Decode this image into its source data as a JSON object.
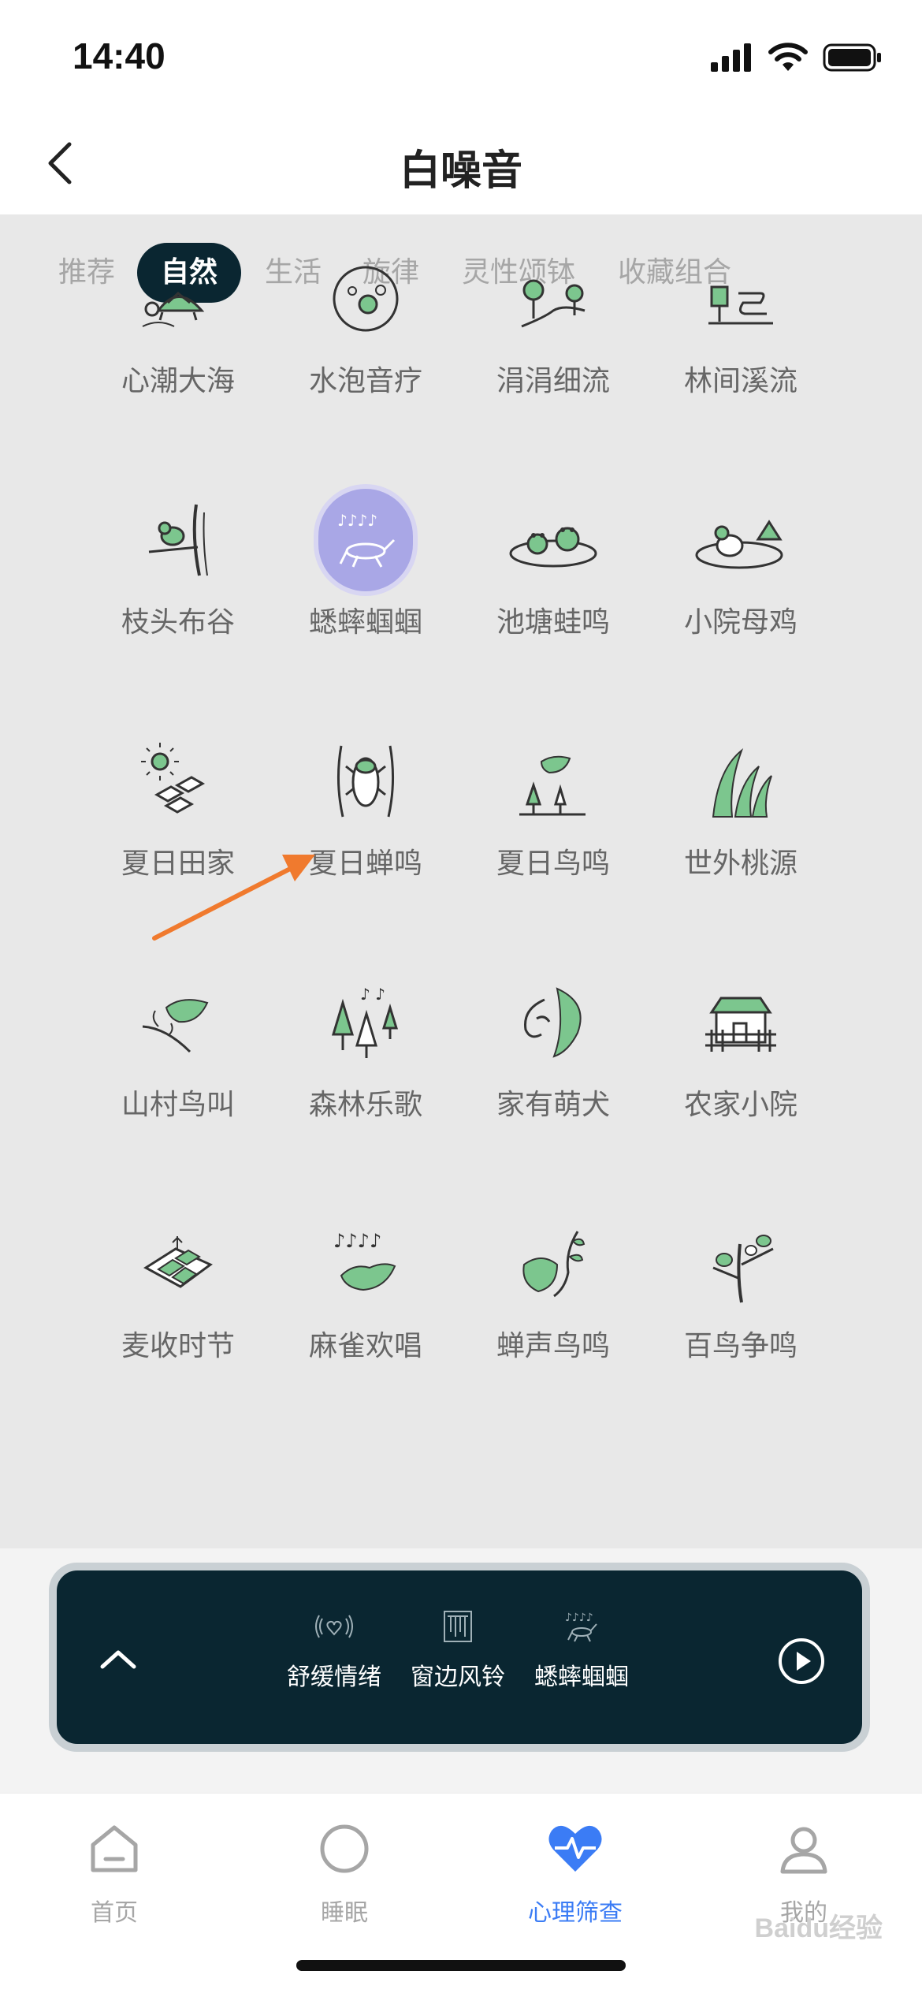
{
  "status_bar": {
    "time": "14:40"
  },
  "nav": {
    "title": "白噪音"
  },
  "tabs": [
    {
      "label": "推荐",
      "active": false
    },
    {
      "label": "自然",
      "active": true
    },
    {
      "label": "生活",
      "active": false
    },
    {
      "label": "旋律",
      "active": false
    },
    {
      "label": "灵性颂钵",
      "active": false
    },
    {
      "label": "收藏组合",
      "active": false
    }
  ],
  "sounds": [
    {
      "label": "心潮大海",
      "icon": "turtle-icon"
    },
    {
      "label": "水泡音疗",
      "icon": "bubbles-icon"
    },
    {
      "label": "涓涓细流",
      "icon": "stream-trees-icon"
    },
    {
      "label": "林间溪流",
      "icon": "forest-stream-icon"
    },
    {
      "label": "枝头布谷",
      "icon": "cuckoo-branch-icon"
    },
    {
      "label": "蟋蟀蝈蝈",
      "icon": "cricket-icon",
      "selected": true
    },
    {
      "label": "池塘蛙鸣",
      "icon": "frogs-pond-icon"
    },
    {
      "label": "小院母鸡",
      "icon": "hen-yard-icon"
    },
    {
      "label": "夏日田家",
      "icon": "sun-fields-icon"
    },
    {
      "label": "夏日蝉鸣",
      "icon": "cicada-icon"
    },
    {
      "label": "夏日鸟鸣",
      "icon": "bird-trees-icon"
    },
    {
      "label": "世外桃源",
      "icon": "grass-icon"
    },
    {
      "label": "山村鸟叫",
      "icon": "bird-branch-icon"
    },
    {
      "label": "森林乐歌",
      "icon": "forest-music-icon"
    },
    {
      "label": "家有萌犬",
      "icon": "dog-icon"
    },
    {
      "label": "农家小院",
      "icon": "farmhouse-icon"
    },
    {
      "label": "麦收时节",
      "icon": "wheat-field-icon"
    },
    {
      "label": "麻雀欢唱",
      "icon": "sparrow-music-icon"
    },
    {
      "label": "蝉声鸟鸣",
      "icon": "bird-leaf-icon"
    },
    {
      "label": "百鸟争鸣",
      "icon": "birds-tree-icon"
    }
  ],
  "player": {
    "tracks": [
      {
        "label": "舒缓情绪",
        "icon": "heart-waves-icon"
      },
      {
        "label": "窗边风铃",
        "icon": "wind-chime-icon"
      },
      {
        "label": "蟋蟀蝈蝈",
        "icon": "cricket-icon"
      }
    ]
  },
  "tabbar": [
    {
      "label": "首页",
      "icon": "home-icon",
      "active": false
    },
    {
      "label": "睡眠",
      "icon": "moon-circle-icon",
      "active": false
    },
    {
      "label": "心理筛查",
      "icon": "heart-pulse-icon",
      "active": true
    },
    {
      "label": "我的",
      "icon": "user-icon",
      "active": false
    }
  ],
  "colors": {
    "accent": "#0a2631",
    "active_tab": "#3b7cf5",
    "icon_green": "#7cc68e",
    "selected_bubble": "#a9a7e6",
    "content_bg": "#e8e8e8"
  },
  "watermark": "Baidu经验"
}
